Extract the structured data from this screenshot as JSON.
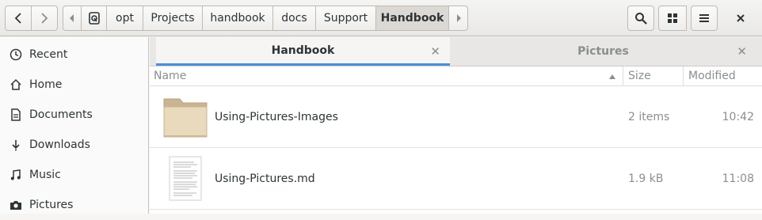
{
  "header": {
    "path": [
      {
        "label": "opt",
        "width": 46
      },
      {
        "label": "Projects",
        "width": 75
      },
      {
        "label": "handbook",
        "width": 89
      },
      {
        "label": "docs",
        "width": 54
      },
      {
        "label": "Support",
        "width": 76
      },
      {
        "label": "Handbook",
        "width": 92,
        "active": true
      }
    ]
  },
  "sidebar": {
    "items": [
      {
        "label": "Recent",
        "icon": "clock-icon"
      },
      {
        "label": "Home",
        "icon": "home-icon"
      },
      {
        "label": "Documents",
        "icon": "document-icon"
      },
      {
        "label": "Downloads",
        "icon": "download-icon"
      },
      {
        "label": "Music",
        "icon": "music-icon"
      },
      {
        "label": "Pictures",
        "icon": "camera-icon"
      }
    ]
  },
  "tabs": [
    {
      "label": "Handbook",
      "active": true
    },
    {
      "label": "Pictures",
      "active": false
    }
  ],
  "columns": {
    "name": "Name",
    "size": "Size",
    "modified": "Modified"
  },
  "files": [
    {
      "name": "Using-Pictures-Images",
      "size": "2 items",
      "modified": "10:42",
      "type": "folder"
    },
    {
      "name": "Using-Pictures.md",
      "size": "1.9 kB",
      "modified": "11:08",
      "type": "text"
    }
  ],
  "colors": {
    "accent": "#4a90d9",
    "folder": "#e6d5b8"
  }
}
